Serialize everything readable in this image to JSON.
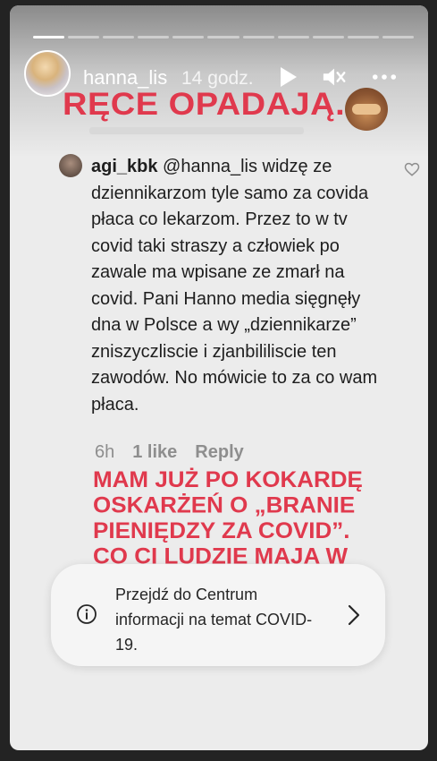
{
  "header": {
    "username": "hanna_lis",
    "time": "14 godz."
  },
  "progress": {
    "segments": 11,
    "active_index": 0
  },
  "icons": {
    "play": "play-icon",
    "mute": "mute-icon",
    "more": "more-icon",
    "heart": "heart-icon",
    "info": "info-icon",
    "chevron": "chevron-right-icon",
    "emoji": "see-no-evil-monkey-icon"
  },
  "overlay": {
    "headline": "RĘCE OPADAJĄ.",
    "caption": "MAM JUŻ PO KOKARDĘ OSKARŻEŃ O „BRANIE PIENIĘDZY ZA COVID”. CO CI LUDZIE MAJA W"
  },
  "comment": {
    "username": "agi_kbk",
    "mention": "@hanna_lis",
    "text": "widzę ze dziennikarzom tyle samo za covida płaca co lekarzom. Przez to w tv covid taki straszy a człowiek po zawale ma wpisane ze zmarł na covid. Pani Hanno media sięgnęły dna w Polsce a wy „dziennikarze” zniszyczliscie i zjanbililiscie ten zawodów. No mówicie to za co wam płaca.",
    "age": "6h",
    "likes": "1 like",
    "reply": "Reply"
  },
  "info_card": {
    "text": "Przejdź do Centrum informacji na temat COVID-19."
  },
  "colors": {
    "accent_red": "#e0394d",
    "background": "#232323",
    "card": "#f5f5f5"
  }
}
